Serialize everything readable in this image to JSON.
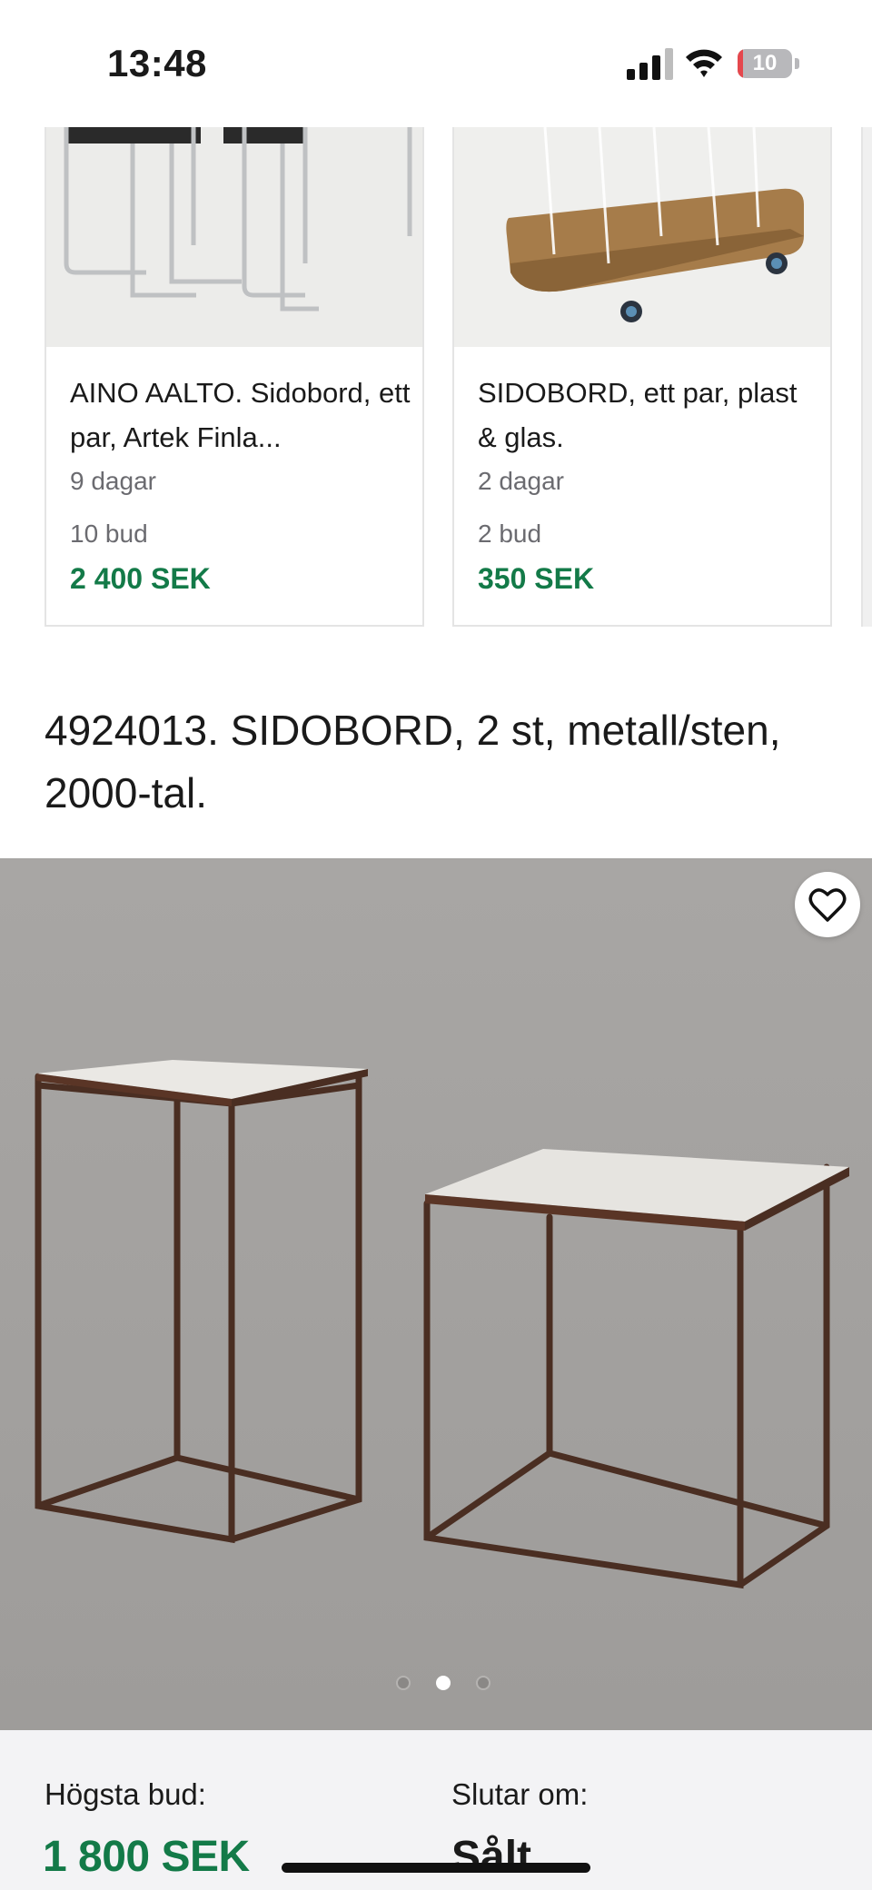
{
  "status_bar": {
    "time": "13:48",
    "battery_level": "10",
    "battery_fraction": 0.1,
    "battery_color": "#e5484d"
  },
  "cards": [
    {
      "title": "AINO AALTO. Sidobord, ett par, Artek Finla...",
      "time_left": "9 dagar",
      "bids": "10 bud",
      "price": "2 400 SEK"
    },
    {
      "title": "SIDOBORD, ett par, plast & glas.",
      "time_left": "2 dagar",
      "bids": "2 bud",
      "price": "350 SEK"
    }
  ],
  "lot": {
    "title": "4924013. SIDOBORD, 2 st, metall/sten, 2000-tal."
  },
  "gallery": {
    "image_count": 3,
    "active_index": 1,
    "favorite_icon": "heart-outline-icon"
  },
  "bottom_bar": {
    "highest_bid_label": "Högsta bud:",
    "highest_bid_value": "1 800 SEK",
    "ends_label": "Slutar om:",
    "ends_value": "Sålt"
  },
  "colors": {
    "price_green": "#137a48",
    "bottom_bar_bg": "#f3f3f5"
  }
}
